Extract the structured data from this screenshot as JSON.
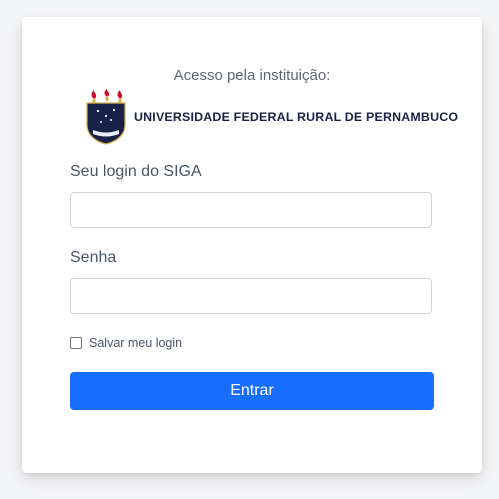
{
  "login": {
    "subtitle": "Acesso pela instituição:",
    "institution": {
      "name": "UNIVERSIDADE FEDERAL RURAL DE PERNAMBUCO",
      "logo_icon": "university-crest-icon",
      "logo_colors": {
        "navy": "#1a2148",
        "red": "#c8102e",
        "gold": "#d8b24a"
      }
    },
    "username": {
      "label": "Seu login do SIGA",
      "value": "",
      "placeholder": ""
    },
    "password": {
      "label": "Senha",
      "value": "",
      "placeholder": ""
    },
    "remember": {
      "label": "Salvar meu login",
      "checked": false
    },
    "submit": {
      "label": "Entrar",
      "color": "#176dfc"
    }
  }
}
